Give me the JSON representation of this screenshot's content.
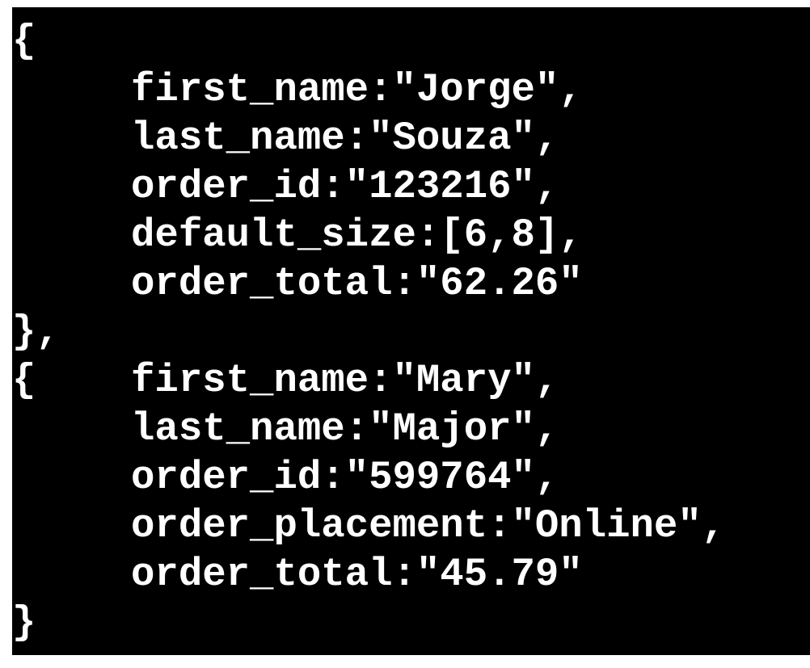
{
  "colors": {
    "background": "#000000",
    "text": "#ffffff",
    "page": "#ffffff"
  },
  "code": {
    "lines": [
      {
        "text": "{"
      },
      {
        "text": "     first_name:\"Jorge\","
      },
      {
        "text": "     last_name:\"Souza\","
      },
      {
        "text": "     order_id:\"123216\","
      },
      {
        "text": "     default_size:[6,8],"
      },
      {
        "text": "     order_total:\"62.26\""
      },
      {
        "text": "},"
      },
      {
        "text": "{    first_name:\"Mary\","
      },
      {
        "text": "     last_name:\"Major\","
      },
      {
        "text": "     order_id:\"599764\","
      },
      {
        "text": "     order_placement:\"Online\","
      },
      {
        "text": "     order_total:\"45.79\""
      },
      {
        "text": "}"
      }
    ]
  }
}
